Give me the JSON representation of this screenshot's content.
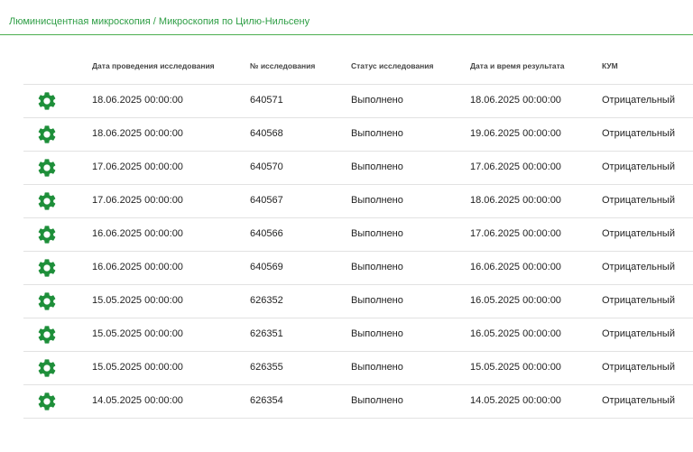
{
  "header": {
    "breadcrumb_part1": "Люминисцентная микроскопия",
    "breadcrumb_separator": " / ",
    "breadcrumb_part2": "Микроскопия по Цилю-Нильсену"
  },
  "table": {
    "columns": [
      "Дата проведения исследования",
      "№ исследования",
      "Статус исследования",
      "Дата и время результата",
      "КУМ"
    ],
    "rows": [
      {
        "date": "18.06.2025 00:00:00",
        "number": "640571",
        "status": "Выполнено",
        "result_date": "18.06.2025 00:00:00",
        "kum": "Отрицательный"
      },
      {
        "date": "18.06.2025 00:00:00",
        "number": "640568",
        "status": "Выполнено",
        "result_date": "19.06.2025 00:00:00",
        "kum": "Отрицательный"
      },
      {
        "date": "17.06.2025 00:00:00",
        "number": "640570",
        "status": "Выполнено",
        "result_date": "17.06.2025 00:00:00",
        "kum": "Отрицательный"
      },
      {
        "date": "17.06.2025 00:00:00",
        "number": "640567",
        "status": "Выполнено",
        "result_date": "18.06.2025 00:00:00",
        "kum": "Отрицательный"
      },
      {
        "date": "16.06.2025 00:00:00",
        "number": "640566",
        "status": "Выполнено",
        "result_date": "17.06.2025 00:00:00",
        "kum": "Отрицательный"
      },
      {
        "date": "16.06.2025 00:00:00",
        "number": "640569",
        "status": "Выполнено",
        "result_date": "16.06.2025 00:00:00",
        "kum": "Отрицательный"
      },
      {
        "date": "15.05.2025 00:00:00",
        "number": "626352",
        "status": "Выполнено",
        "result_date": "16.05.2025 00:00:00",
        "kum": "Отрицательный"
      },
      {
        "date": "15.05.2025 00:00:00",
        "number": "626351",
        "status": "Выполнено",
        "result_date": "16.05.2025 00:00:00",
        "kum": "Отрицательный"
      },
      {
        "date": "15.05.2025 00:00:00",
        "number": "626355",
        "status": "Выполнено",
        "result_date": "15.05.2025 00:00:00",
        "kum": "Отрицательный"
      },
      {
        "date": "14.05.2025 00:00:00",
        "number": "626354",
        "status": "Выполнено",
        "result_date": "14.05.2025 00:00:00",
        "kum": "Отрицательный"
      }
    ],
    "row_icon": "gear-icon"
  },
  "colors": {
    "accent": "#2e9e45",
    "gear": "#1e8f3a",
    "divider": "#e2e2e2"
  }
}
